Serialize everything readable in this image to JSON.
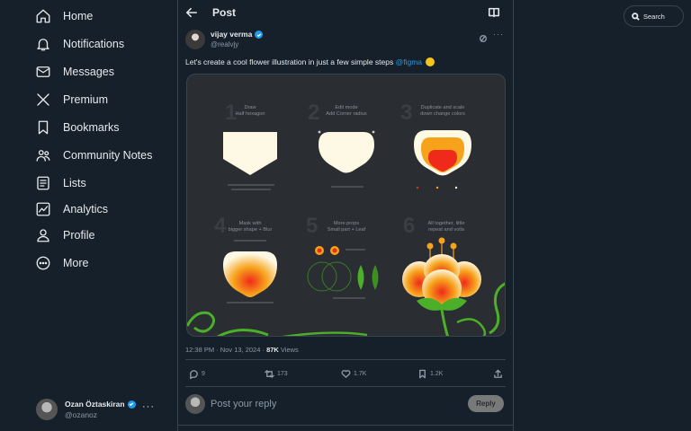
{
  "nav": {
    "items": [
      {
        "label": "Home",
        "icon": "home-icon"
      },
      {
        "label": "Notifications",
        "icon": "bell-icon"
      },
      {
        "label": "Messages",
        "icon": "envelope-icon"
      },
      {
        "label": "Premium",
        "icon": "x-logo-icon"
      },
      {
        "label": "Bookmarks",
        "icon": "bookmark-icon"
      },
      {
        "label": "Community Notes",
        "icon": "people-icon"
      },
      {
        "label": "Lists",
        "icon": "list-icon"
      },
      {
        "label": "Analytics",
        "icon": "chart-icon"
      },
      {
        "label": "Profile",
        "icon": "person-icon"
      },
      {
        "label": "More",
        "icon": "more-circle-icon"
      }
    ]
  },
  "account": {
    "name": "Ozan Öztaskiran",
    "handle": "@ozanoz",
    "more": "···"
  },
  "header": {
    "title": "Post"
  },
  "post": {
    "author_name": "vijay verma",
    "author_handle": "@realvjy",
    "more": "···",
    "text_before": "Let's create a cool flower illustration in just a few simple steps ",
    "mention": "@figma",
    "time": "12:38 PM · Nov 13, 2024 · ",
    "views": "87K",
    "views_label": " Views",
    "media": {
      "steps": [
        {
          "num": "1",
          "line1": "Draw",
          "line2": "Half hexagon"
        },
        {
          "num": "2",
          "line1": "Edit mode",
          "line2": "Add Corner radius"
        },
        {
          "num": "3",
          "line1": "Duplicate and scale",
          "line2": "down change colors"
        },
        {
          "num": "4",
          "line1": "Mask with",
          "line2": "bigger shape + Blur"
        },
        {
          "num": "5",
          "line1": "More props",
          "line2": "Small part + Leaf"
        },
        {
          "num": "6",
          "line1": "All together, little",
          "line2": "repeat and voila"
        }
      ],
      "colors": {
        "cream": "#fdf9e4",
        "orange": "#f7a21b",
        "red": "#ef2a1a",
        "green": "#4caf2a",
        "bg": "#2a2d31"
      }
    },
    "actions": {
      "replies": "9",
      "reposts": "173",
      "likes": "1.7K",
      "bookmarks": "1.2K"
    }
  },
  "reply": {
    "placeholder": "Post your reply",
    "button": "Reply"
  },
  "search": {
    "label": "Search"
  }
}
